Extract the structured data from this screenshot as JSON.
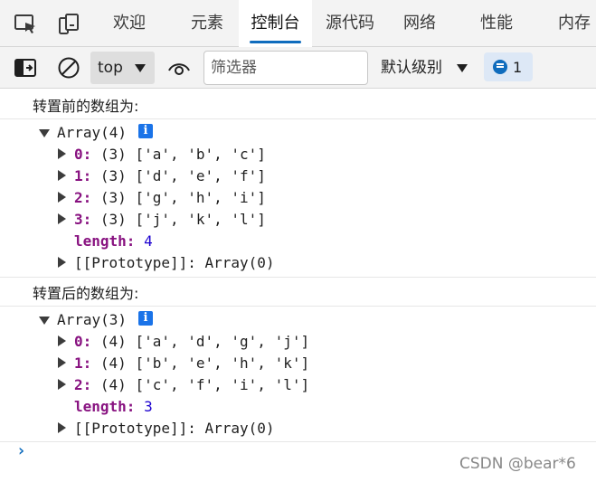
{
  "tabs": [
    {
      "label": "欢迎"
    },
    {
      "label": "元素"
    },
    {
      "label": "控制台"
    },
    {
      "label": "源代码"
    },
    {
      "label": "网络"
    },
    {
      "label": "性能"
    },
    {
      "label": "内存"
    }
  ],
  "toolbar": {
    "context": "top",
    "filter_placeholder": "筛选器",
    "levels": "默认级别",
    "issues_count": "1"
  },
  "console": {
    "msg1": "转置前的数组为:",
    "arr1": {
      "header": "Array(4)",
      "rows": [
        {
          "key": "0",
          "rest": " (3) ['a', 'b', 'c']"
        },
        {
          "key": "1",
          "rest": " (3) ['d', 'e', 'f']"
        },
        {
          "key": "2",
          "rest": " (3) ['g', 'h', 'i']"
        },
        {
          "key": "3",
          "rest": " (3) ['j', 'k', 'l']"
        }
      ],
      "length_key": "length",
      "length_val": "4",
      "proto": "[[Prototype]]: Array(0)"
    },
    "msg2": "转置后的数组为:",
    "arr2": {
      "header": "Array(3)",
      "rows": [
        {
          "key": "0",
          "rest": " (4) ['a', 'd', 'g', 'j']"
        },
        {
          "key": "1",
          "rest": " (4) ['b', 'e', 'h', 'k']"
        },
        {
          "key": "2",
          "rest": " (4) ['c', 'f', 'i', 'l']"
        }
      ],
      "length_key": "length",
      "length_val": "3",
      "proto": "[[Prototype]]: Array(0)"
    },
    "prompt": "›"
  },
  "watermark": "CSDN @bear*6"
}
